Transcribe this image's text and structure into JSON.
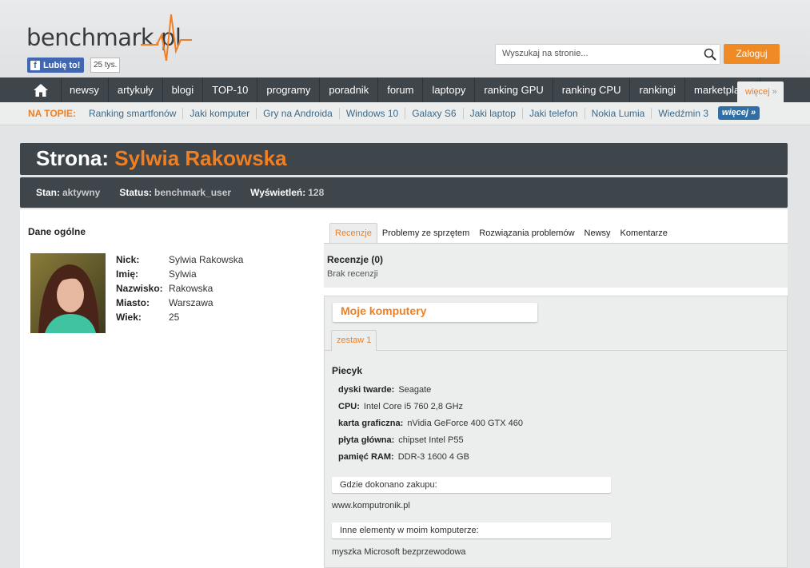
{
  "header": {
    "logo_text": "benchmark",
    "logo_dot": ".",
    "logo_tld": "pl",
    "fb_like_label": "Lubię to!",
    "fb_count": "25 tys.",
    "search_placeholder": "Wyszukaj na stronie...",
    "login_label": "Zaloguj"
  },
  "nav": {
    "items": [
      {
        "label": "newsy"
      },
      {
        "label": "artykuły"
      },
      {
        "label": "blogi"
      },
      {
        "label": "TOP-10"
      },
      {
        "label": "programy"
      },
      {
        "label": "poradnik"
      },
      {
        "label": "forum"
      },
      {
        "label": "laptopy"
      },
      {
        "label": "ranking GPU"
      },
      {
        "label": "ranking CPU"
      },
      {
        "label": "rankingi"
      },
      {
        "label": "marketplace"
      }
    ],
    "more_label": "więcej"
  },
  "topics": {
    "label": "NA TOPIE:",
    "items": [
      {
        "label": "Ranking smartfonów"
      },
      {
        "label": "Jaki komputer"
      },
      {
        "label": "Gry na Androida"
      },
      {
        "label": "Windows 10"
      },
      {
        "label": "Galaxy S6"
      },
      {
        "label": "Jaki laptop"
      },
      {
        "label": "Jaki telefon"
      },
      {
        "label": "Nokia Lumia"
      },
      {
        "label": "Wiedźmin 3"
      }
    ],
    "more_label": "więcej"
  },
  "page": {
    "title_prefix": "Strona:",
    "title_name": "Sylwia Rakowska",
    "stan_label": "Stan:",
    "stan_value": "aktywny",
    "status_label": "Status:",
    "status_value": "benchmark_user",
    "views_label": "Wyświetleń:",
    "views_value": "128"
  },
  "profile": {
    "section_title": "Dane ogólne",
    "fields": [
      {
        "label": "Nick:",
        "value": "Sylwia Rakowska"
      },
      {
        "label": "Imię:",
        "value": "Sylwia"
      },
      {
        "label": "Nazwisko:",
        "value": "Rakowska"
      },
      {
        "label": "Miasto:",
        "value": "Warszawa"
      },
      {
        "label": "Wiek:",
        "value": "25"
      }
    ]
  },
  "tabs": {
    "items": [
      {
        "label": "Recenzje"
      },
      {
        "label": "Problemy ze sprzętem"
      },
      {
        "label": "Rozwiązania problemów"
      },
      {
        "label": "Newsy"
      },
      {
        "label": "Komentarze"
      }
    ]
  },
  "reviews": {
    "heading": "Recenzje (0)",
    "empty_text": "Brak recenzji"
  },
  "computers": {
    "title": "Moje komputery",
    "set_tab": "zestaw 1",
    "pc_name": "Piecyk",
    "specs": [
      {
        "label": "dyski twarde:",
        "value": "Seagate"
      },
      {
        "label": "CPU:",
        "value": "Intel Core i5 760 2,8 GHz"
      },
      {
        "label": "karta graficzna:",
        "value": "nVidia GeForce 400 GTX 460"
      },
      {
        "label": "płyta główna:",
        "value": "chipset Intel P55"
      },
      {
        "label": "pamięć RAM:",
        "value": "DDR-3 1600 4 GB"
      }
    ],
    "purchase_label": "Gdzie dokonano zakupu:",
    "purchase_value": "www.komputronik.pl",
    "other_label": "Inne elementy w moim komputerze:",
    "other_value": "myszka Microsoft bezprzewodowa"
  },
  "colors": {
    "accent": "#f07f22",
    "nav_bg": "#3e454b",
    "link": "#3a6a8c",
    "fb_blue": "#4267b2"
  }
}
